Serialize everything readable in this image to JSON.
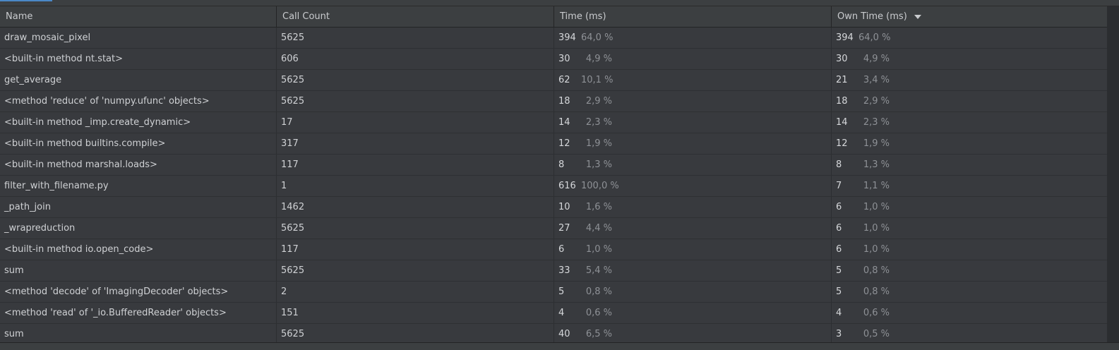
{
  "columns": {
    "name": "Name",
    "call_count": "Call Count",
    "time": "Time (ms)",
    "own_time": "Own Time (ms)"
  },
  "rows": [
    {
      "name": "draw_mosaic_pixel",
      "count": "5625",
      "time": "394",
      "time_pct": "64,0 %",
      "own": "394",
      "own_pct": "64,0 %"
    },
    {
      "name": "<built-in method nt.stat>",
      "count": "606",
      "time": "30",
      "time_pct": "4,9 %",
      "own": "30",
      "own_pct": "4,9 %"
    },
    {
      "name": "get_average",
      "count": "5625",
      "time": "62",
      "time_pct": "10,1 %",
      "own": "21",
      "own_pct": "3,4 %"
    },
    {
      "name": "<method 'reduce' of 'numpy.ufunc' objects>",
      "count": "5625",
      "time": "18",
      "time_pct": "2,9 %",
      "own": "18",
      "own_pct": "2,9 %"
    },
    {
      "name": "<built-in method _imp.create_dynamic>",
      "count": "17",
      "time": "14",
      "time_pct": "2,3 %",
      "own": "14",
      "own_pct": "2,3 %"
    },
    {
      "name": "<built-in method builtins.compile>",
      "count": "317",
      "time": "12",
      "time_pct": "1,9 %",
      "own": "12",
      "own_pct": "1,9 %"
    },
    {
      "name": "<built-in method marshal.loads>",
      "count": "117",
      "time": "8",
      "time_pct": "1,3 %",
      "own": "8",
      "own_pct": "1,3 %"
    },
    {
      "name": "filter_with_filename.py",
      "count": "1",
      "time": "616",
      "time_pct": "100,0 %",
      "own": "7",
      "own_pct": "1,1 %"
    },
    {
      "name": "_path_join",
      "count": "1462",
      "time": "10",
      "time_pct": "1,6 %",
      "own": "6",
      "own_pct": "1,0 %"
    },
    {
      "name": "_wrapreduction",
      "count": "5625",
      "time": "27",
      "time_pct": "4,4 %",
      "own": "6",
      "own_pct": "1,0 %"
    },
    {
      "name": "<built-in method io.open_code>",
      "count": "117",
      "time": "6",
      "time_pct": "1,0 %",
      "own": "6",
      "own_pct": "1,0 %"
    },
    {
      "name": "sum",
      "count": "5625",
      "time": "33",
      "time_pct": "5,4 %",
      "own": "5",
      "own_pct": "0,8 %"
    },
    {
      "name": "<method 'decode' of 'ImagingDecoder' objects>",
      "count": "2",
      "time": "5",
      "time_pct": "0,8 %",
      "own": "5",
      "own_pct": "0,8 %"
    },
    {
      "name": "<method 'read' of '_io.BufferedReader' objects>",
      "count": "151",
      "time": "4",
      "time_pct": "0,6 %",
      "own": "4",
      "own_pct": "0,6 %"
    },
    {
      "name": "sum",
      "count": "5625",
      "time": "40",
      "time_pct": "6,5 %",
      "own": "3",
      "own_pct": "0,5 %"
    }
  ]
}
